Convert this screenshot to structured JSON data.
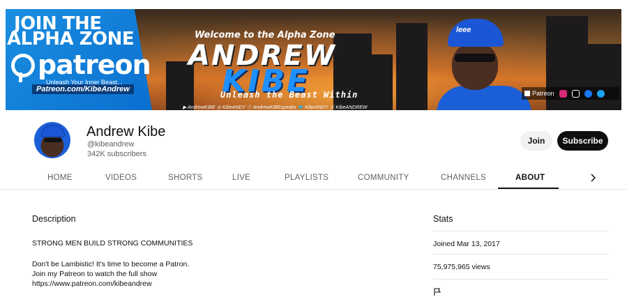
{
  "banner": {
    "join_line1": "JOIN THE",
    "join_line2": "ALPHA ZONE",
    "patreon_word": "patreon",
    "patreon_tagline": "Unleash Your Inner Beast...",
    "patreon_url": "Patreon.com/KibeAndrew",
    "welcome": "Welcome to the Alpha Zone",
    "title_first": "ANDREW",
    "title_last": "KIBE",
    "slogan": "Unleash the Beast Within",
    "socials_strip": "▶ AndrewKIBE ◎ KibeANDY ⓕ AndrewKIBEspeaks 🐦 KibeANDY ⓟ KibeANDREW",
    "cap_text": "leee",
    "link_label": "Patreon"
  },
  "channel": {
    "name": "Andrew Kibe",
    "handle": "@kibeandrew",
    "subscribers": "342K subscribers",
    "join_label": "Join",
    "subscribe_label": "Subscribe"
  },
  "tabs": [
    {
      "label": "HOME"
    },
    {
      "label": "VIDEOS"
    },
    {
      "label": "SHORTS"
    },
    {
      "label": "LIVE"
    },
    {
      "label": "PLAYLISTS"
    },
    {
      "label": "COMMUNITY"
    },
    {
      "label": "CHANNELS"
    },
    {
      "label": "ABOUT"
    }
  ],
  "active_tab": "ABOUT",
  "about": {
    "description_heading": "Description",
    "lines": [
      "STRONG MEN BUILD STRONG COMMUNITIES",
      "Don't be Lambistic! It's time to become a Patron.",
      "Join my Patreon to watch the full show",
      "https://www.patreon.com/kibeandrew"
    ],
    "stats_heading": "Stats",
    "joined": "Joined Mar 13, 2017",
    "views": "75,975,965 views"
  },
  "icons": {
    "next": "chevron-right-icon",
    "report": "flag-icon"
  },
  "colors": {
    "subscribe_bg": "#0f0f0f",
    "join_bg": "#f2f2f2",
    "brand_blue": "#1a56d6"
  }
}
